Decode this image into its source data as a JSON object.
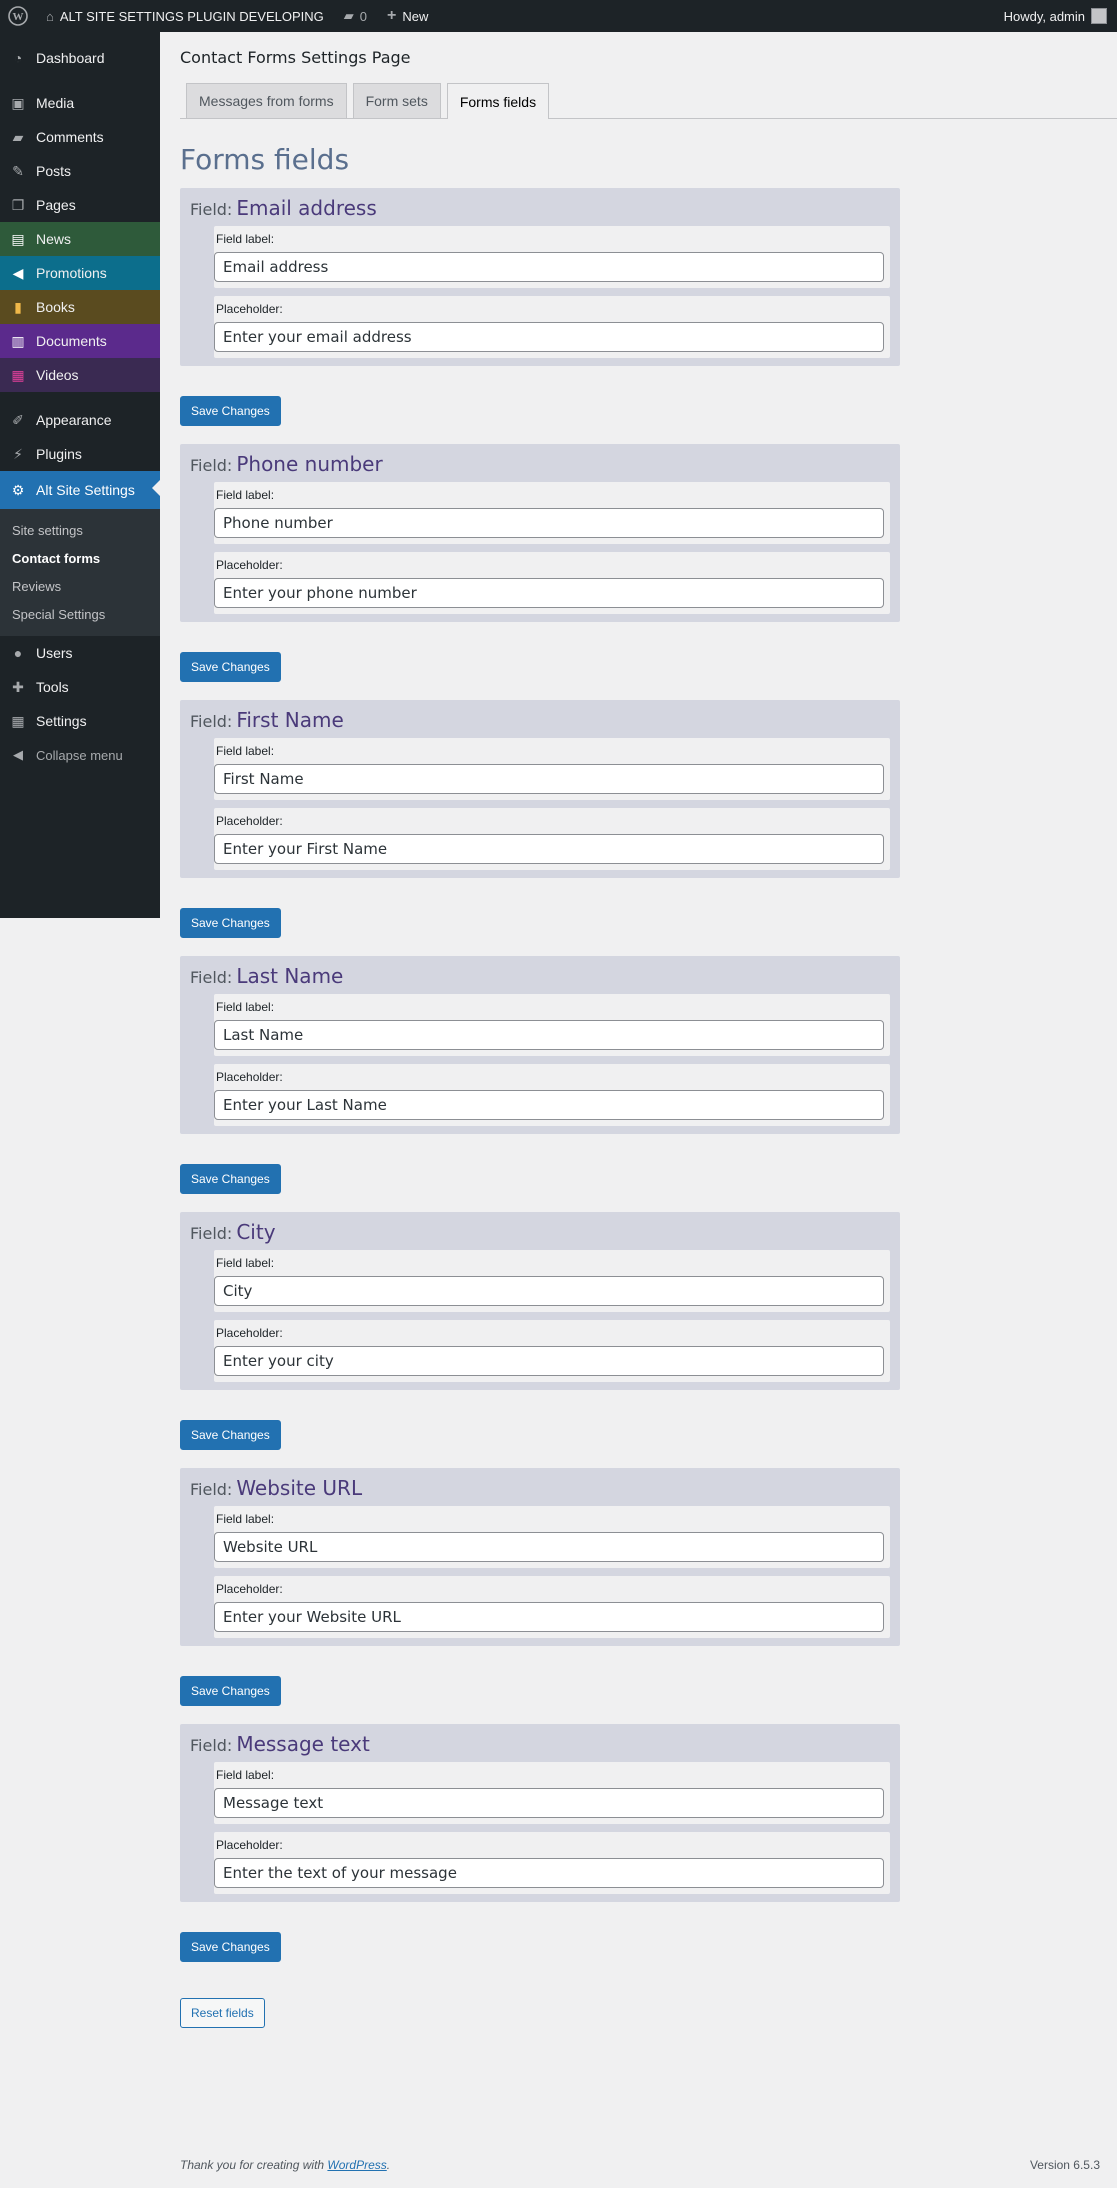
{
  "adminbar": {
    "site_name": "ALT SITE SETTINGS PLUGIN DEVELOPING",
    "comments_count": "0",
    "new_label": "New",
    "howdy": "Howdy, admin"
  },
  "sidebar": {
    "items": [
      {
        "label": "Dashboard",
        "icon": "dashboard-icon"
      },
      {
        "label": "Media",
        "icon": "media-icon"
      },
      {
        "label": "Comments",
        "icon": "comments-icon"
      },
      {
        "label": "Posts",
        "icon": "posts-icon"
      },
      {
        "label": "Pages",
        "icon": "pages-icon"
      },
      {
        "label": "News",
        "icon": "news-icon",
        "bg": "#2e5a3a"
      },
      {
        "label": "Promotions",
        "icon": "megaphone-icon",
        "bg": "#0c6e8c"
      },
      {
        "label": "Books",
        "icon": "book-icon",
        "bg": "#5a4b1f"
      },
      {
        "label": "Documents",
        "icon": "documents-icon",
        "bg": "#5b2a8c"
      },
      {
        "label": "Videos",
        "icon": "video-icon",
        "bg": "#3a2a52"
      },
      {
        "label": "Appearance",
        "icon": "appearance-icon"
      },
      {
        "label": "Plugins",
        "icon": "plugins-icon"
      },
      {
        "label": "Alt Site Settings",
        "icon": "gear-icon"
      },
      {
        "label": "Users",
        "icon": "users-icon"
      },
      {
        "label": "Tools",
        "icon": "tools-icon"
      },
      {
        "label": "Settings",
        "icon": "settings-icon"
      },
      {
        "label": "Collapse menu",
        "icon": "collapse-icon"
      }
    ],
    "submenu": [
      "Site settings",
      "Contact forms",
      "Reviews",
      "Special Settings"
    ]
  },
  "page": {
    "title": "Contact Forms Settings Page",
    "tabs": [
      "Messages from forms",
      "Form sets",
      "Forms fields"
    ],
    "section_title": "Forms fields",
    "field_prefix": "Field:",
    "label_caption": "Field label:",
    "placeholder_caption": "Placeholder:",
    "save_label": "Save Changes",
    "reset_label": "Reset fields",
    "fields": [
      {
        "name": "Email address",
        "label": "Email address",
        "placeholder": "Enter your email address"
      },
      {
        "name": "Phone number",
        "label": "Phone number",
        "placeholder": "Enter your phone number"
      },
      {
        "name": "First Name",
        "label": "First Name",
        "placeholder": "Enter your First Name"
      },
      {
        "name": "Last Name",
        "label": "Last Name",
        "placeholder": "Enter your Last Name"
      },
      {
        "name": "City",
        "label": "City",
        "placeholder": "Enter your city"
      },
      {
        "name": "Website URL",
        "label": "Website URL",
        "placeholder": "Enter your Website URL"
      },
      {
        "name": "Message text",
        "label": "Message text",
        "placeholder": "Enter the text of your message"
      }
    ]
  },
  "footer": {
    "thanks_prefix": "Thank you for creating with",
    "thanks_link": "WordPress",
    "thanks_suffix": ".",
    "version": "Version 6.5.3"
  }
}
